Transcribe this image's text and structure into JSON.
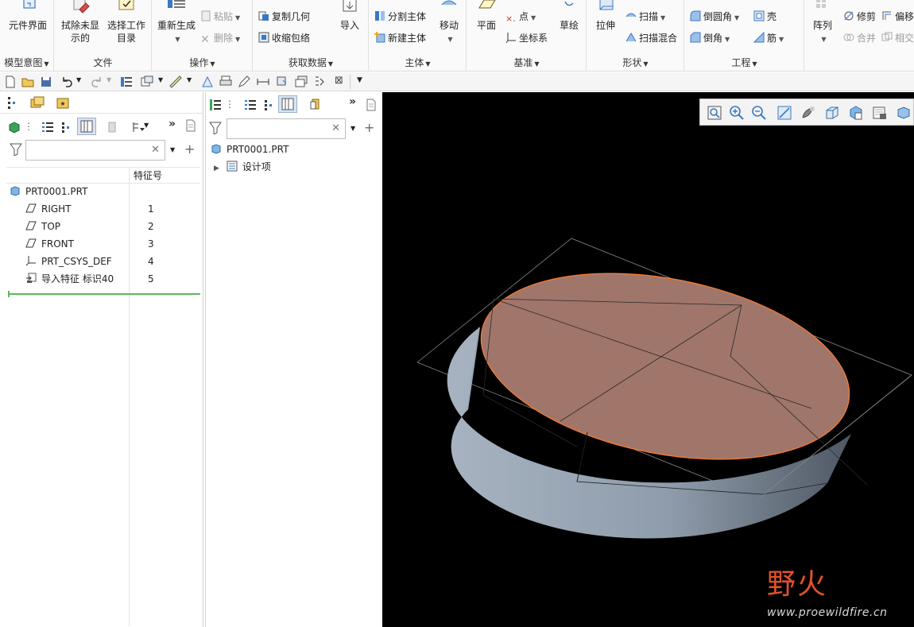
{
  "ribbon": {
    "groups": {
      "model_intent": "模型意图",
      "file": "文件",
      "operations": "操作",
      "get_data": "获取数据",
      "body": "主体",
      "datum": "基准",
      "shapes": "形状",
      "engineering": "工程"
    },
    "buttons": {
      "component_interface": "元件界面",
      "erase_undisplayed_l1": "拭除未显",
      "erase_undisplayed_l2": "示的",
      "select_working_dir_l1": "选择工作",
      "select_working_dir_l2": "目录",
      "regenerate": "重新生成",
      "paste": "粘贴",
      "delete": "删除",
      "copy_geometry": "复制几何",
      "shrinkwrap": "收缩包络",
      "import": "导入",
      "split_body": "分割主体",
      "new_body": "新建主体",
      "move": "移动",
      "plane": "平面",
      "point": "点",
      "coordinate_system": "坐标系",
      "sketch": "草绘",
      "extrude": "拉伸",
      "sweep": "扫描",
      "swept_blend": "扫描混合",
      "round": "倒圆角",
      "chamfer": "倒角",
      "shell": "壳",
      "rib": "筋",
      "pattern": "阵列",
      "trim": "修剪",
      "offset": "偏移",
      "merge": "合并",
      "intersect": "相交"
    }
  },
  "model_tree": {
    "column_header": "特征号",
    "root": "PRT0001.PRT",
    "items": [
      {
        "label": "RIGHT",
        "num": "1",
        "icon": "datum-plane-icon"
      },
      {
        "label": "TOP",
        "num": "2",
        "icon": "datum-plane-icon"
      },
      {
        "label": "FRONT",
        "num": "3",
        "icon": "datum-plane-icon"
      },
      {
        "label": "PRT_CSYS_DEF",
        "num": "4",
        "icon": "coordinate-system-icon"
      },
      {
        "label": "导入特征 标识40",
        "num": "5",
        "icon": "import-feature-icon"
      }
    ]
  },
  "detail_tree": {
    "root": "PRT0001.PRT",
    "items": [
      {
        "label": "设计项"
      }
    ]
  },
  "watermark": {
    "logo": "野火",
    "url": "www.proewildfire.cn"
  },
  "colors": {
    "viewport_bg": "#000000",
    "part_body": "#9aa6b4",
    "part_top_face": "#a0766a",
    "highlight_edge": "#ff7a2e",
    "insert_indicator": "#5cb85c"
  }
}
